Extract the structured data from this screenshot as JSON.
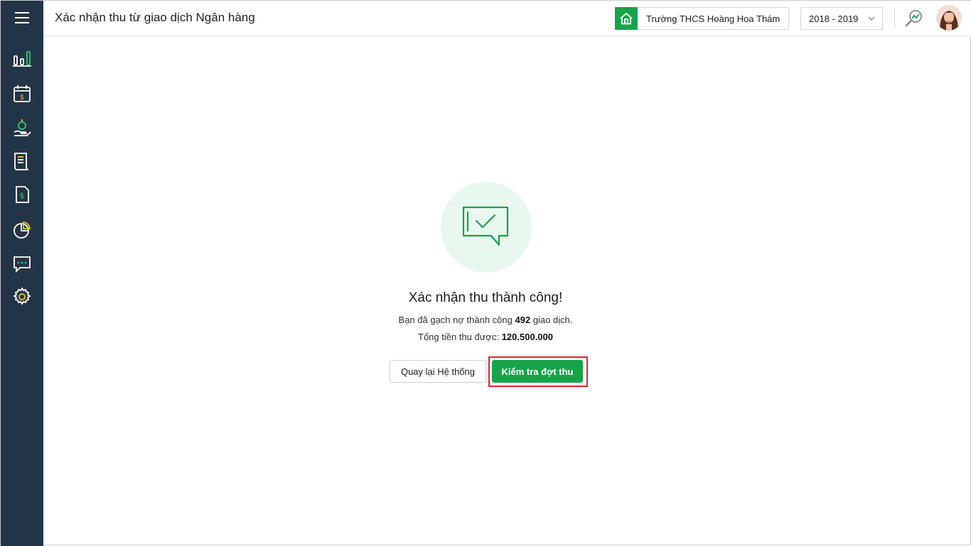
{
  "header": {
    "title": "Xác nhận thu từ giao dịch Ngân hàng",
    "school": "Trường THCS Hoàng Hoa Thám",
    "year": "2018 - 2019"
  },
  "sidebar": {
    "items": [
      {
        "icon": "bar-chart-icon"
      },
      {
        "icon": "calendar-dollar-icon"
      },
      {
        "icon": "money-hand-icon"
      },
      {
        "icon": "receipt-scroll-icon"
      },
      {
        "icon": "document-dollar-icon"
      },
      {
        "icon": "pie-chart-icon"
      },
      {
        "icon": "chat-bubble-icon"
      },
      {
        "icon": "settings-gear-icon"
      }
    ]
  },
  "result": {
    "title": "Xác nhận thu thành công!",
    "line1_prefix": "Bạn đã gạch nợ thành công",
    "line1_count": "492",
    "line1_suffix": "giao dịch.",
    "line2_prefix": "Tổng tiền thu được:",
    "line2_amount": "120.500.000",
    "back_button": "Quay lại Hệ thống",
    "check_button": "Kiểm tra đợt thu"
  },
  "colors": {
    "sidebar_bg": "#243447",
    "primary_green": "#17a34a",
    "highlight_red": "#e0242b"
  }
}
